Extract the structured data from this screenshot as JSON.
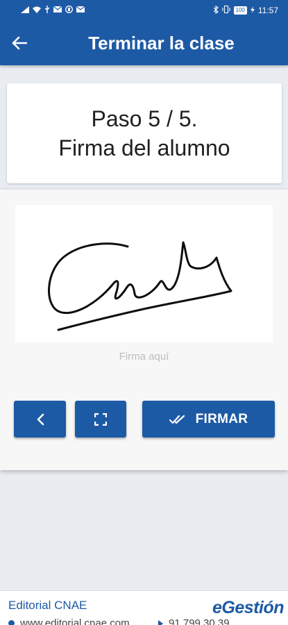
{
  "status_bar": {
    "left_icons": [
      "signal-icon",
      "wifi-icon",
      "usb-icon",
      "mail-icon",
      "shield-icon",
      "mail-icon"
    ],
    "battery": "100",
    "time": "11:57"
  },
  "app_bar": {
    "title": "Terminar la clase",
    "back_icon": "arrow-left-icon"
  },
  "step": {
    "line1": "Paso 5 / 5.",
    "line2": "Firma del alumno"
  },
  "signature": {
    "hint": "Firma aquí"
  },
  "actions": {
    "prev_icon": "chevron-left-icon",
    "fullscreen_icon": "fullscreen-icon",
    "sign_icon": "double-check-icon",
    "sign_label": "FIRMAR"
  },
  "footer": {
    "company": "Editorial CNAE",
    "brand": "eGestión",
    "website": "www.editorial.cnae.com",
    "phone": "91 799 30 39"
  },
  "colors": {
    "primary": "#1d5aa5",
    "background": "#e9edf2",
    "hint": "#bdbdbd"
  }
}
